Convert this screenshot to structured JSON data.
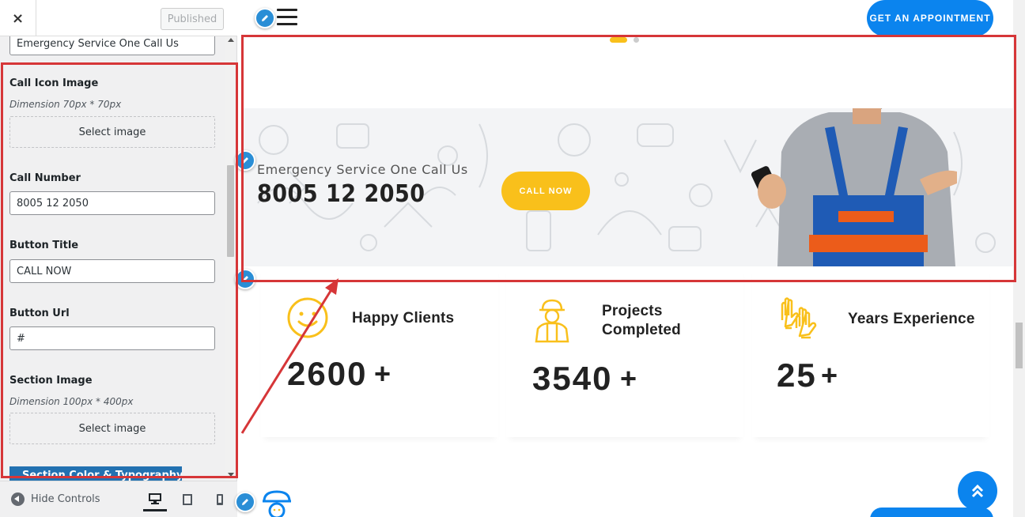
{
  "customizer": {
    "close_label": "×",
    "publish_label": "Published",
    "top_field_value": "Emergency Service One Call Us",
    "call_icon": {
      "label": "Call Icon Image",
      "dimension": "Dimension 70px * 70px",
      "select_label": "Select image"
    },
    "call_number": {
      "label": "Call Number",
      "value": "8005 12 2050"
    },
    "button_title": {
      "label": "Button Title",
      "value": "CALL NOW"
    },
    "button_url": {
      "label": "Button Url",
      "value": "#"
    },
    "section_image": {
      "label": "Section Image",
      "dimension": "Dimension 100px * 400px",
      "select_label": "Select image"
    },
    "section_button_label": "Section Color & Typography",
    "hide_controls_label": "Hide Controls",
    "devices": [
      "desktop-icon",
      "tablet-icon",
      "mobile-icon"
    ]
  },
  "preview": {
    "appointment_label": "GET AN APPOINTMENT",
    "slider_active_index": 0,
    "slider_count": 2,
    "emergency_title": "Emergency Service One Call Us",
    "phone_number": "8005 12 2050",
    "call_button_label": "CALL NOW",
    "stats": [
      {
        "label_line1": "Happy Clients",
        "label_line2": "",
        "value": "2600",
        "suffix": "+",
        "icon": "smiley-icon"
      },
      {
        "label_line1": "Projects",
        "label_line2": "Completed",
        "value": "3540",
        "suffix": "+",
        "icon": "worker-icon"
      },
      {
        "label_line1": "Years Experience",
        "label_line2": "",
        "value": "25",
        "suffix": "+",
        "icon": "gloves-icon"
      }
    ]
  },
  "colors": {
    "accent_blue": "#0b84ee",
    "accent_yellow": "#f9c01b",
    "annotation_red": "#d63638",
    "wp_blue": "#2271b1"
  }
}
